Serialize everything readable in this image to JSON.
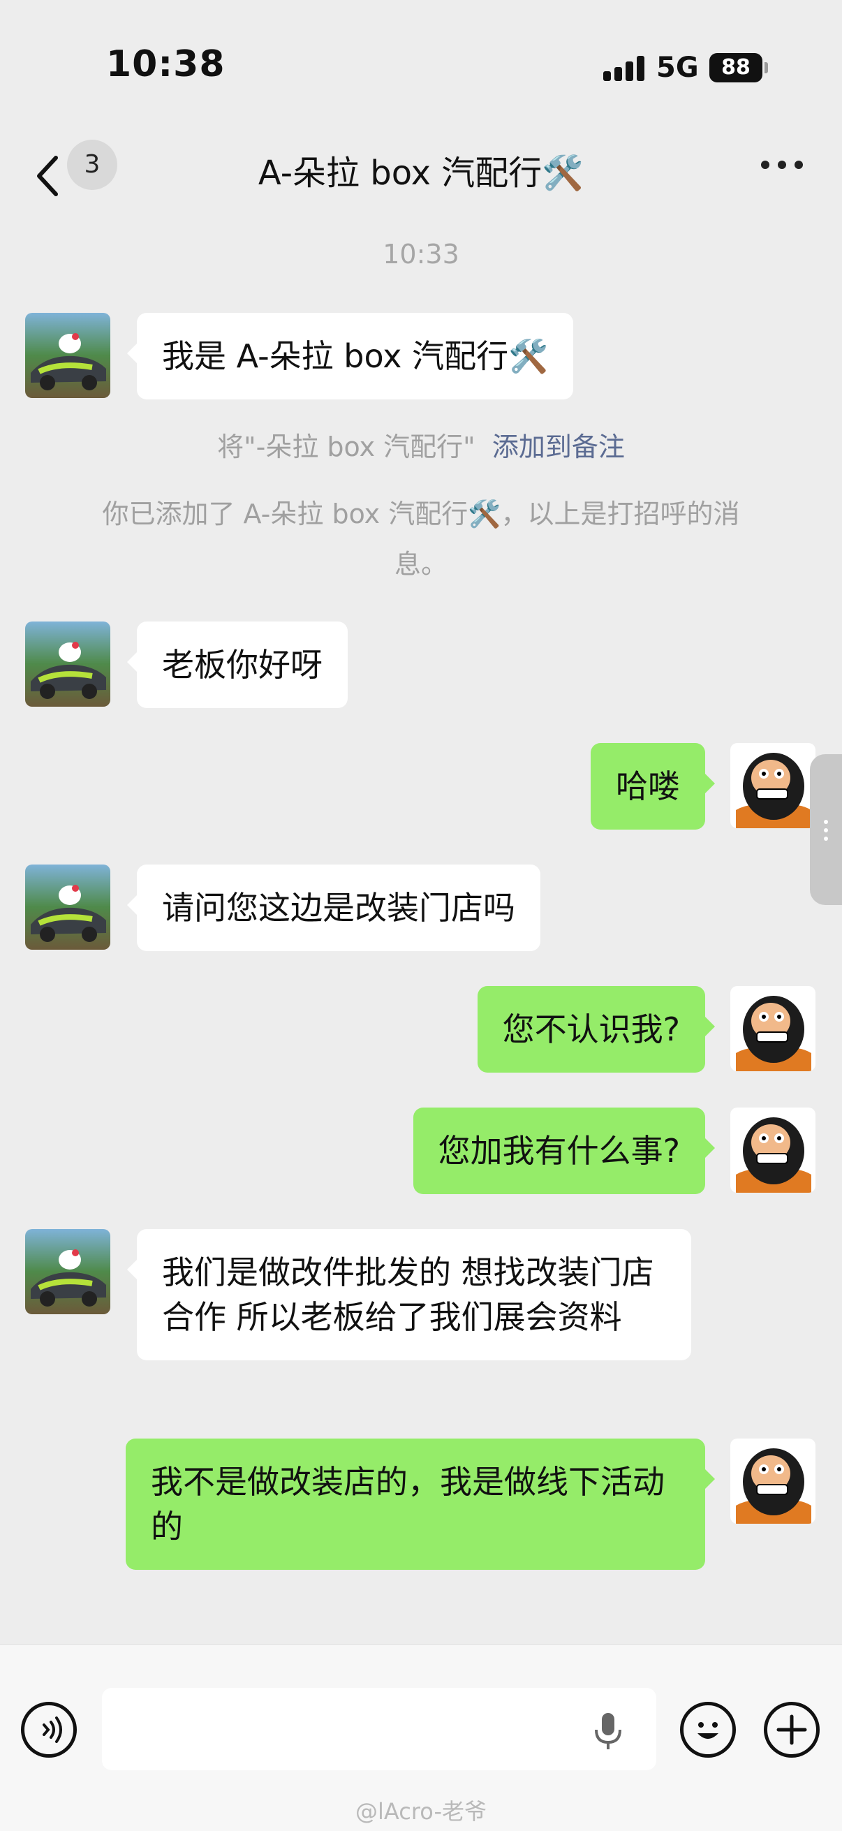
{
  "status_bar": {
    "time": "10:38",
    "network": "5G",
    "battery": "88"
  },
  "nav": {
    "back_icon": "chevron-left-icon",
    "unread_count": "3",
    "title": "A-朵拉 box 汽配行🛠️",
    "more_icon": "more-dots-icon"
  },
  "chat": {
    "timestamp": "10:33",
    "system_remark_prefix": "将\"-朵拉 box 汽配行\"",
    "system_remark_link": "添加到备注",
    "system_added_line1": "你已添加了 A-朵拉 box 汽配行🛠️，以上是打招呼的消",
    "system_added_line2": "息。",
    "messages": [
      {
        "side": "in",
        "text": "我是 A-朵拉 box 汽配行🛠️"
      },
      {
        "side": "in",
        "text": "老板你好呀"
      },
      {
        "side": "out",
        "text": "哈喽"
      },
      {
        "side": "in",
        "text": "请问您这边是改装门店吗"
      },
      {
        "side": "out",
        "text": "您不认识我?"
      },
      {
        "side": "out",
        "text": "您加我有什么事?"
      },
      {
        "side": "in",
        "text": "我们是做改件批发的 想找改装门店合作 所以老板给了我们展会资料"
      },
      {
        "side": "out",
        "text": "我不是做改装店的，我是做线下活动的"
      }
    ]
  },
  "input_bar": {
    "voice_icon": "voice-mode-icon",
    "mic_icon": "microphone-icon",
    "emoji_icon": "emoji-icon",
    "plus_icon": "plus-icon",
    "input_value": ""
  },
  "watermark": "@lAcro-老爷",
  "colors": {
    "background": "#ededed",
    "outgoing_bubble": "#95ec69",
    "incoming_bubble": "#ffffff",
    "link": "#5b6b92"
  }
}
